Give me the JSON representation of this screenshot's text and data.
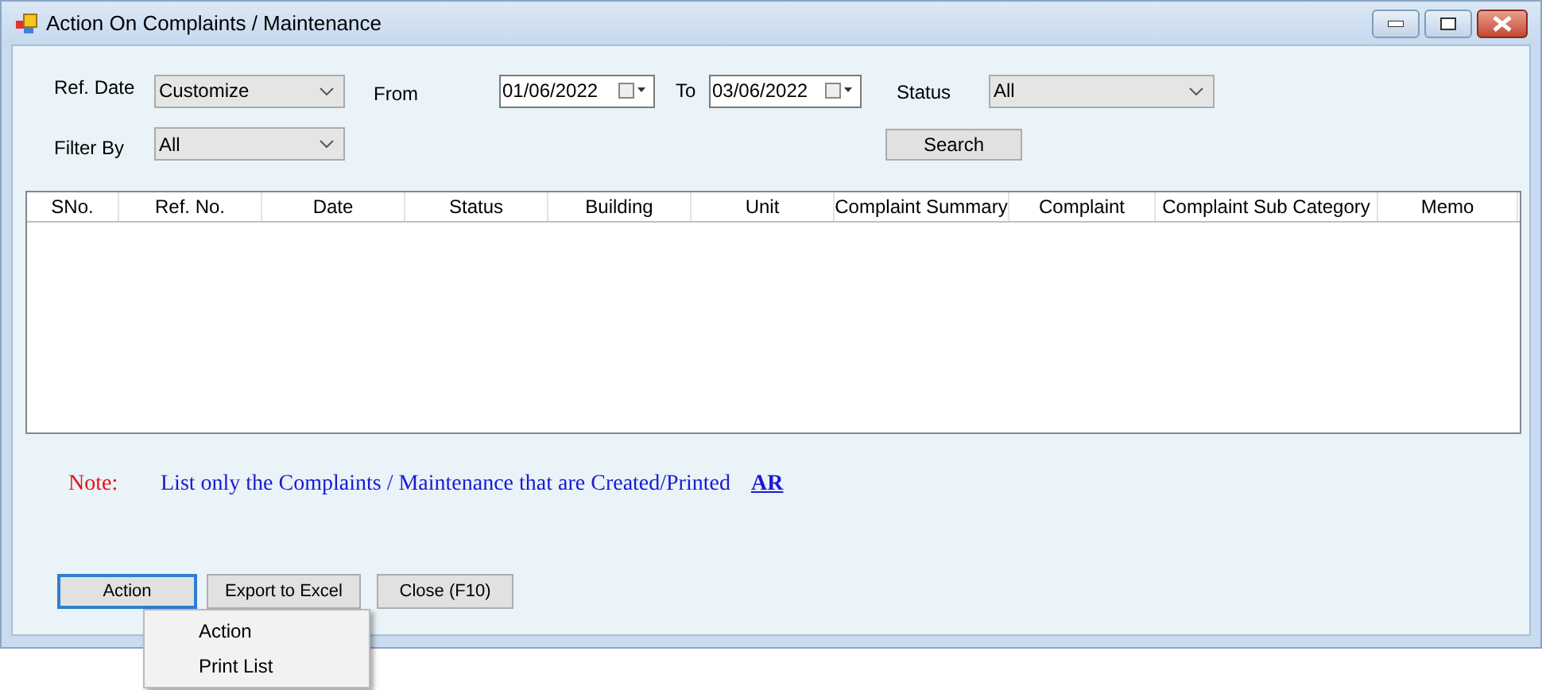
{
  "window": {
    "title": "Action On Complaints / Maintenance"
  },
  "filters": {
    "ref_date": {
      "label": "Ref. Date",
      "value": "Customize"
    },
    "from": {
      "label": "From",
      "value": "01/06/2022"
    },
    "to": {
      "label": "To",
      "value": "03/06/2022"
    },
    "status": {
      "label": "Status",
      "value": "All"
    },
    "filter_by": {
      "label": "Filter By",
      "value": "All"
    },
    "search_button": "Search"
  },
  "table": {
    "columns": [
      "SNo.",
      "Ref. No.",
      "Date",
      "Status",
      "Building",
      "Unit",
      "Complaint Summary",
      "Complaint",
      "Complaint Sub Category",
      "Memo"
    ]
  },
  "note": {
    "label": "Note:",
    "text": "List only the Complaints / Maintenance that are Created/Printed",
    "link": "AR"
  },
  "buttons": [
    {
      "label": "Action",
      "focused": true
    },
    {
      "label": "Export to Excel",
      "focused": false
    },
    {
      "label": "Close (F10)",
      "focused": false
    }
  ],
  "context_menu": {
    "items": [
      "Action",
      "Print List"
    ]
  }
}
